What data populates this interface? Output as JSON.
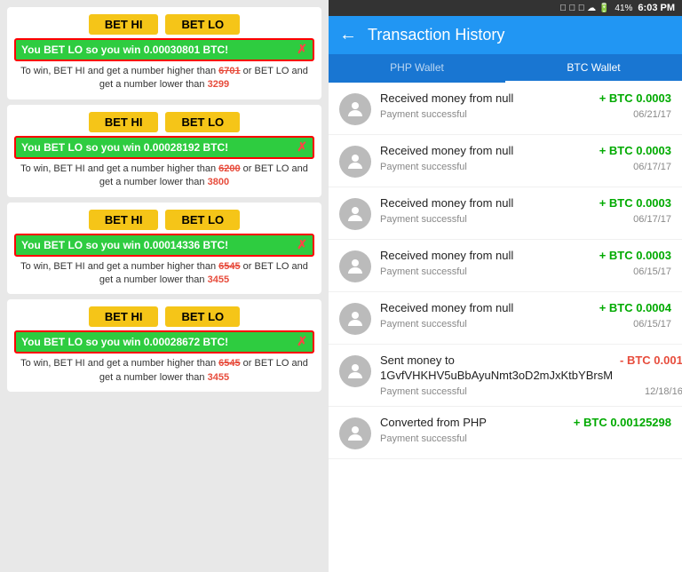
{
  "statusBar": {
    "signal": "▲▲▲",
    "battery": "41%",
    "time": "6:03 PM"
  },
  "header": {
    "back": "←",
    "title": "Transaction History"
  },
  "tabs": [
    {
      "label": "PHP Wallet",
      "active": false
    },
    {
      "label": "BTC Wallet",
      "active": true
    }
  ],
  "transactions": [
    {
      "title": "Received money from null",
      "amount": "+ BTC 0.0003",
      "amountType": "positive",
      "status": "Payment successful",
      "date": "06/21/17"
    },
    {
      "title": "Received money from null",
      "amount": "+ BTC 0.0003",
      "amountType": "positive",
      "status": "Payment successful",
      "date": "06/17/17"
    },
    {
      "title": "Received money from null",
      "amount": "+ BTC 0.0003",
      "amountType": "positive",
      "status": "Payment successful",
      "date": "06/17/17"
    },
    {
      "title": "Received money from null",
      "amount": "+ BTC 0.0003",
      "amountType": "positive",
      "status": "Payment successful",
      "date": "06/15/17"
    },
    {
      "title": "Received money from null",
      "amount": "+ BTC 0.0004",
      "amountType": "positive",
      "status": "Payment successful",
      "date": "06/15/17"
    },
    {
      "title": "Sent money to 1GvfVHKHV5uBbAyuNmt3oD2mJxKtbYBrsM",
      "amount": "- BTC 0.001",
      "amountType": "negative",
      "status": "Payment successful",
      "date": "12/18/16"
    },
    {
      "title": "Converted from PHP",
      "amount": "+ BTC 0.00125298",
      "amountType": "positive",
      "status": "Payment successful",
      "date": ""
    }
  ],
  "betCards": [
    {
      "winText": "You BET LO so you win 0.00030801 BTC!",
      "desc1": "To win, BET HI and get a number higher than",
      "hiNum": "6701",
      "desc2": "or BET LO and get a number lower than",
      "loNum": "3299"
    },
    {
      "winText": "You BET LO so you win 0.00028192 BTC!",
      "desc1": "To win, BET HI and get a number higher than",
      "hiNum": "6200",
      "desc2": "or BET LO and get a number lower than",
      "loNum": "3800"
    },
    {
      "winText": "You BET LO so you win 0.00014336 BTC!",
      "desc1": "To win, BET HI and get a number higher than",
      "hiNum": "6545",
      "desc2": "or BET LO and get a number lower than",
      "loNum": "3455"
    },
    {
      "winText": "You BET LO so you win 0.00028672 BTC!",
      "desc1": "To win, BET HI and get a number higher than",
      "hiNum": "6545",
      "desc2": "or BET LO and get a number lower than",
      "loNum": "3455"
    }
  ],
  "betButtonLabels": {
    "hi": "BET HI",
    "lo": "BET LO"
  }
}
